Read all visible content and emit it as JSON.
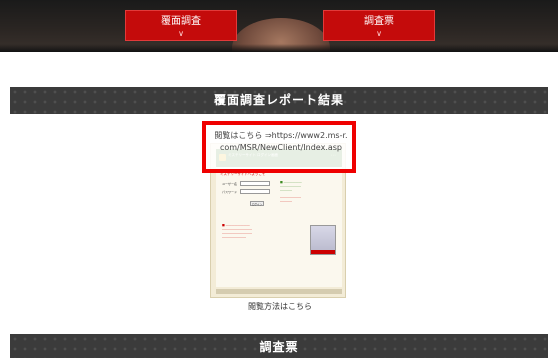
{
  "nav": {
    "items": [
      {
        "label": "覆面調査",
        "icon": "chevron-down-icon"
      },
      {
        "label": "調査票",
        "icon": "chevron-down-icon"
      }
    ],
    "accent_color": "#c40b0b"
  },
  "sections": {
    "report_title": "覆面調査レポート結果",
    "survey_title": "調査票"
  },
  "highlight": {
    "prefix": "閲覧はこちら ⇒",
    "url": "https://www2.ms-r.com/MSR/NewClient/Index.asp",
    "border_color": "#ef0000"
  },
  "thumbnail": {
    "header_title": "ミステリーサイト ログイン画面",
    "page_heading": "ミステリーサイトへようこそ",
    "field_labels": [
      "ユーザー名",
      "パスワード"
    ],
    "login_button": "ログイン",
    "icon": "site-logo-icon"
  },
  "view_link": "閲覧方法はこちら"
}
